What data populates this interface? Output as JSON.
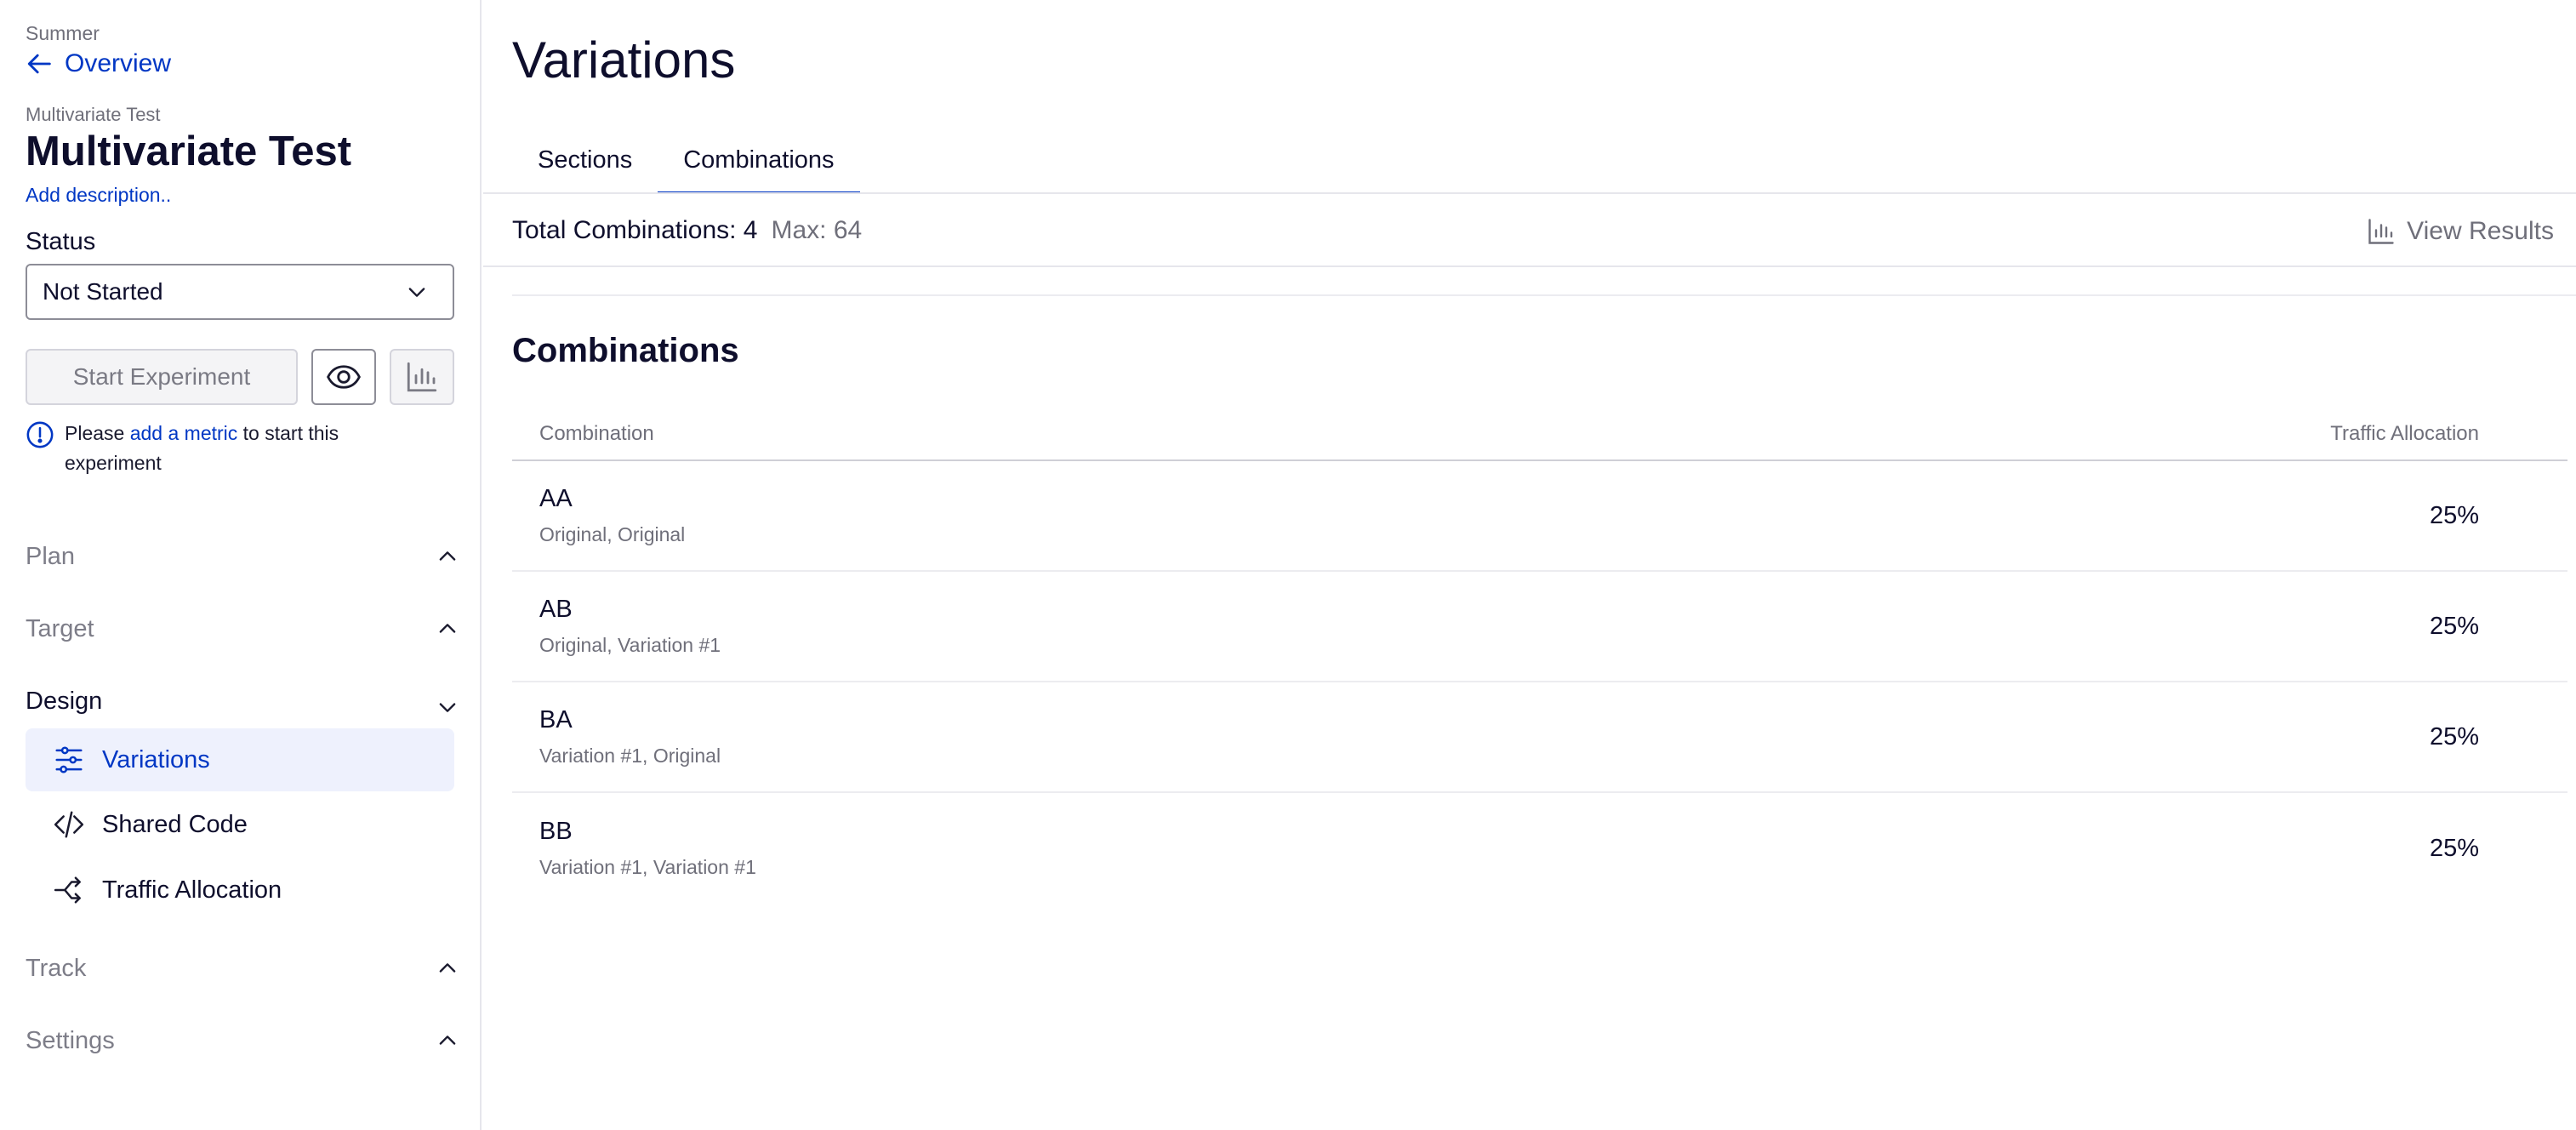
{
  "sidebar": {
    "project_name": "Summer",
    "back_label": "Overview",
    "experiment_type": "Multivariate Test",
    "experiment_title": "Multivariate Test",
    "add_description": "Add description..",
    "status_label": "Status",
    "status_value": "Not Started",
    "start_button": "Start Experiment",
    "notice": {
      "prefix": "Please",
      "link": "add a metric",
      "suffix": "to start this experiment"
    },
    "sections": {
      "plan": "Plan",
      "target": "Target",
      "design": "Design",
      "track": "Track",
      "settings": "Settings"
    },
    "design_items": [
      {
        "label": "Variations",
        "icon": "sliders-icon"
      },
      {
        "label": "Shared Code",
        "icon": "code-icon"
      },
      {
        "label": "Traffic Allocation",
        "icon": "split-icon"
      }
    ]
  },
  "main": {
    "title": "Variations",
    "tabs": [
      {
        "label": "Sections"
      },
      {
        "label": "Combinations",
        "active": true
      }
    ],
    "totals": {
      "total_label": "Total Combinations: 4",
      "max_label": "Max: 64"
    },
    "view_results": "View Results",
    "section_title": "Combinations",
    "table": {
      "headers": [
        "Combination",
        "Traffic Allocation"
      ],
      "rows": [
        {
          "name": "AA",
          "desc": "Original, Original",
          "allocation": "25%"
        },
        {
          "name": "AB",
          "desc": "Original, Variation #1",
          "allocation": "25%"
        },
        {
          "name": "BA",
          "desc": "Variation #1, Original",
          "allocation": "25%"
        },
        {
          "name": "BB",
          "desc": "Variation #1, Variation #1",
          "allocation": "25%"
        }
      ]
    }
  },
  "colors": {
    "accent": "#0037c4",
    "selected_bg": "#eef1fd",
    "muted_text": "#6f6f7a",
    "border": "#e6e6ec"
  }
}
